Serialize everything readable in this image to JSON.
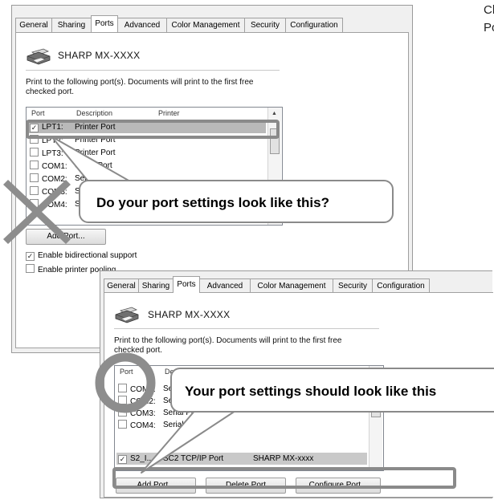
{
  "intro_text": "Check the port settings on the Ports tab of the printer properties.",
  "tabs": [
    "General",
    "Sharing",
    "Ports",
    "Advanced",
    "Color Management",
    "Security",
    "Configuration"
  ],
  "printer_name": "SHARP MX-XXXX",
  "port_description": "Print to the following port(s). Documents will print to the first free checked port.",
  "columns": {
    "port": "Port",
    "description": "Description",
    "printer": "Printer"
  },
  "wrong_dialog": {
    "ports": [
      {
        "port": "LPT1:",
        "description": "Printer Port",
        "checked": true
      },
      {
        "port": "LPT2:",
        "description": "Printer Port",
        "checked": false
      },
      {
        "port": "LPT3:",
        "description": "Printer Port",
        "checked": false
      },
      {
        "port": "COM1:",
        "description": "Serial Port",
        "checked": false
      },
      {
        "port": "COM2:",
        "description": "Serial Port",
        "checked": false
      },
      {
        "port": "COM3:",
        "description": "Serial Port",
        "checked": false
      },
      {
        "port": "COM4:",
        "description": "Serial Port",
        "checked": false
      }
    ],
    "bidirectional_label": "Enable bidirectional support",
    "bidirectional_checked": true,
    "pooling_label": "Enable printer pooling",
    "pooling_checked": false,
    "add_port_short": "Add Port..."
  },
  "right_dialog": {
    "ports": [
      {
        "port": "COM1:",
        "description": "Serial Port",
        "printer": "",
        "checked": false
      },
      {
        "port": "COM2:",
        "description": "Serial Port",
        "printer": "",
        "checked": false
      },
      {
        "port": "COM3:",
        "description": "Serial Port",
        "printer": "",
        "checked": false
      },
      {
        "port": "COM4:",
        "description": "Serial Port",
        "printer": "",
        "checked": false
      },
      {
        "port": "S2_I...",
        "description": "SC2 TCP/IP Port",
        "printer": "SHARP MX-xxxx",
        "checked": true
      }
    ],
    "add_port_label": "Add Port...",
    "delete_port_label": "Delete Port",
    "configure_port_label": "Configure Port..."
  },
  "callouts": {
    "wrong": "Do your port settings look like this?",
    "right": "Your port settings should look like this"
  }
}
